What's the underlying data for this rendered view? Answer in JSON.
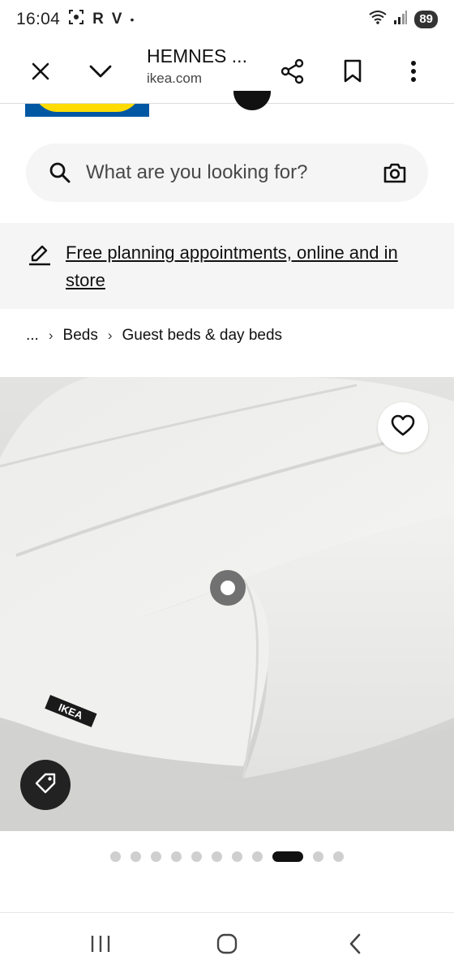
{
  "status_bar": {
    "time": "16:04",
    "indicators": [
      "screen-record-icon",
      "R",
      "V",
      "•"
    ],
    "indicator_r": "R",
    "indicator_v": "V",
    "indicator_dot": "•",
    "battery": "89"
  },
  "toolbar": {
    "title": "HEMNES ...",
    "url": "ikea.com",
    "close_icon": "close-icon",
    "collapse_icon": "chevron-down-icon",
    "share_icon": "share-icon",
    "bookmark_icon": "bookmark-icon",
    "menu_icon": "more-vert-icon"
  },
  "search": {
    "placeholder": "What are you looking for?",
    "icon": "search-icon",
    "camera_icon": "camera-icon"
  },
  "promo": {
    "text": "Free planning appointments, online and in store",
    "icon": "pencil-icon"
  },
  "breadcrumb": {
    "items": [
      "...",
      "Beds",
      "Guest beds & day beds"
    ],
    "separator": "›"
  },
  "product_gallery": {
    "favorite_icon": "heart-icon",
    "tag_icon": "price-tag-icon",
    "brand_label": "IKEA",
    "total_images": 11,
    "active_index": 8,
    "colors": {
      "active_dot": "#111111",
      "dot": "#cfcfcf"
    }
  },
  "nav_bar": {
    "recents_icon": "recents-icon",
    "home_icon": "home-icon",
    "back_icon": "back-icon"
  },
  "colors": {
    "ikea_blue": "#0058a3",
    "ikea_yellow": "#ffdb00",
    "surface_gray": "#f5f5f5"
  }
}
